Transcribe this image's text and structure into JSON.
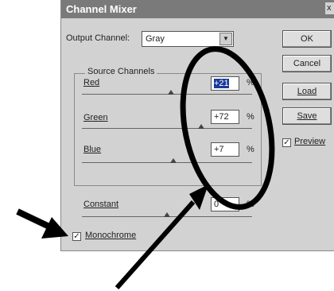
{
  "dialog": {
    "title": "Channel Mixer",
    "close_label": "x",
    "output_channel": {
      "label": "Output Channel:",
      "value": "Gray"
    },
    "buttons": {
      "ok": "OK",
      "cancel": "Cancel",
      "load": "Load",
      "save": "Save"
    },
    "preview": {
      "label": "Preview",
      "checked": true
    },
    "source_channels": {
      "label": "Source Channels",
      "red": {
        "label": "Red",
        "value": "+21",
        "unit": "%"
      },
      "green": {
        "label": "Green",
        "value": "+72",
        "unit": "%"
      },
      "blue": {
        "label": "Blue",
        "value": "+7",
        "unit": "%"
      }
    },
    "constant": {
      "label": "Constant",
      "value": "0",
      "unit": "%"
    },
    "monochrome": {
      "label": "Monochrome",
      "checked": true
    }
  },
  "colors": {
    "titlebar": "#7a7a7a",
    "dialog_bg": "#d2d2d2",
    "annotation": "#000000",
    "selection": "#1a3a9a"
  }
}
